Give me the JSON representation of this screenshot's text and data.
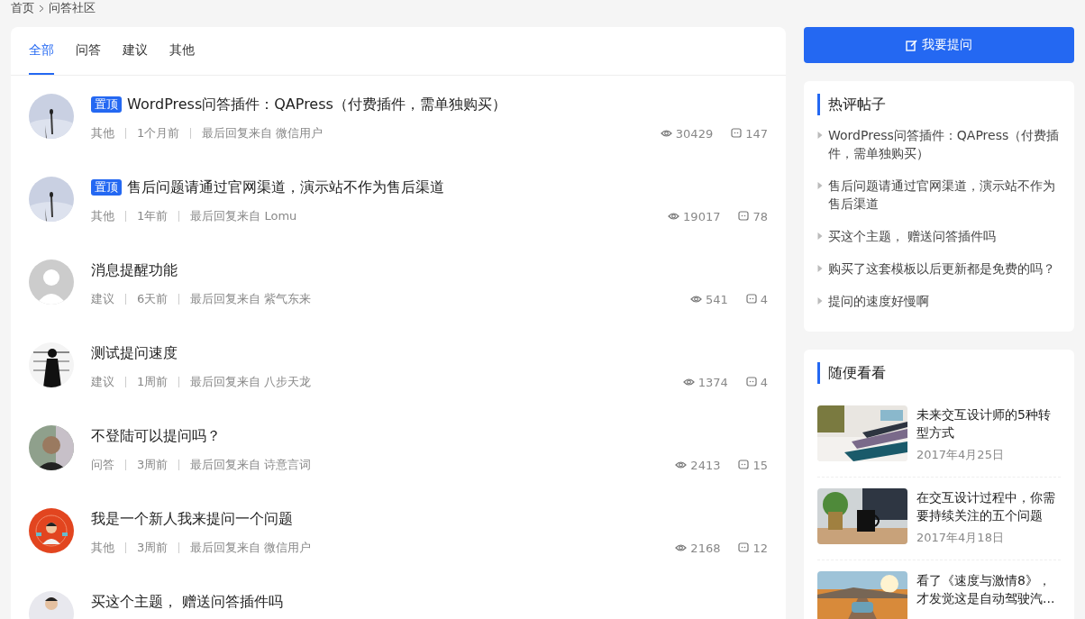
{
  "breadcrumb": [
    "首页",
    "问答社区"
  ],
  "tabs": [
    {
      "label": "全部",
      "selected": true
    },
    {
      "label": "问答",
      "selected": false
    },
    {
      "label": "建议",
      "selected": false
    },
    {
      "label": "其他",
      "selected": false
    }
  ],
  "posts": [
    {
      "badge": "置顶",
      "title": "WordPress问答插件：QAPress（付费插件，需单独购买）",
      "category": "其他",
      "time": "1个月前",
      "last_reply": "最后回复来自 微信用户",
      "views": "30429",
      "comments": "147"
    },
    {
      "badge": "置顶",
      "title": "售后问题请通过官网渠道，演示站不作为售后渠道",
      "category": "其他",
      "time": "1年前",
      "last_reply": "最后回复来自 Lomu",
      "views": "19017",
      "comments": "78"
    },
    {
      "avatar": {
        "kind": "default"
      },
      "title": "消息提醒功能",
      "category": "建议",
      "time": "6天前",
      "last_reply": "最后回复来自 紫气东来",
      "views": "541",
      "comments": "4"
    },
    {
      "title": "测试提问速度",
      "category": "建议",
      "time": "1周前",
      "last_reply": "最后回复来自 八步天龙",
      "views": "1374",
      "comments": "4"
    },
    {
      "title": "不登陆可以提问吗？",
      "category": "问答",
      "time": "3周前",
      "last_reply": "最后回复来自 诗意言词",
      "views": "2413",
      "comments": "15"
    },
    {
      "title": "我是一个新人我来提问一个问题",
      "category": "其他",
      "time": "3周前",
      "last_reply": "最后回复来自 微信用户",
      "views": "2168",
      "comments": "12"
    },
    {
      "title": "买这个主题， 赠送问答插件吗"
    }
  ],
  "ask_button": "我要提问",
  "hot_posts": {
    "title": "热评帖子",
    "items": [
      "WordPress问答插件：QAPress（付费插件，需单独购买）",
      "售后问题请通过官网渠道，演示站不作为售后渠道",
      "买这个主题， 赠送问答插件吗",
      "购买了这套模板以后更新都是免费的吗？",
      "提问的速度好慢啊"
    ]
  },
  "random": {
    "title": "随便看看",
    "items": [
      {
        "title": "未来交互设计师的5种转型方式",
        "date": "2017年4月25日"
      },
      {
        "title": "在交互设计过程中，你需要持续关注的五个问题",
        "date": "2017年4月18日"
      },
      {
        "title": "看了《速度与激情8》，才发觉这是自动驾驶汽..."
      }
    ]
  }
}
